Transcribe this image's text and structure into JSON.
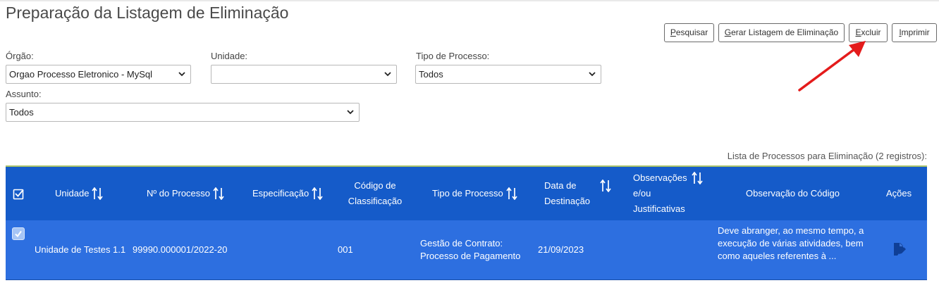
{
  "page": {
    "title": "Preparação da Listagem de Eliminação"
  },
  "toolbar": {
    "pesquisar": {
      "access_key": "P",
      "rest": "esquisar"
    },
    "gerar": {
      "access_key": "G",
      "rest": "erar Listagem de Eliminação"
    },
    "excluir": {
      "access_key": "E",
      "rest": "xcluir"
    },
    "imprimir": {
      "access_key": "I",
      "rest": "mprimir"
    }
  },
  "filters": {
    "orgao": {
      "label": "Órgão:",
      "value": "Orgao Processo Eletronico - MySql"
    },
    "unidade": {
      "label": "Unidade:",
      "value": ""
    },
    "tipo_processo": {
      "label": "Tipo de Processo:",
      "value": "Todos"
    },
    "assunto": {
      "label": "Assunto:",
      "value": "Todos"
    }
  },
  "table": {
    "caption": "Lista de Processos para Eliminação (2 registros):",
    "headers": {
      "unidade": "Unidade",
      "numero": "Nº do Processo",
      "especificacao": "Especificação",
      "codigo_1": "Código de",
      "codigo_2": "Classificação",
      "tipo": "Tipo de Processo",
      "data_1": "Data de",
      "data_2": "Destinação",
      "obs_1": "Observações",
      "obs_2": "e/ou",
      "obs_3": "Justificativas",
      "obs_codigo": "Observação do Código",
      "acoes": "Ações"
    },
    "rows": [
      {
        "checked": true,
        "unidade": "Unidade de Testes 1.1",
        "numero": "99990.000001/2022-20",
        "especificacao": "",
        "codigo": "001",
        "tipo_1": "Gestão de Contrato:",
        "tipo_2": "Processo de Pagamento",
        "data": "21/09/2023",
        "observacoes": "",
        "obs_codigo_1": "Deve abranger, ao mesmo tempo, a",
        "obs_codigo_2": "execução de várias atividades, bem",
        "obs_codigo_3": "como aqueles referentes à ..."
      }
    ]
  },
  "colors": {
    "header_bg": "#155bc9",
    "row_selected_bg": "#2d6fe0",
    "annotation_arrow": "#e41b1b"
  },
  "icons": [
    "chevron-down-icon",
    "sort-icon",
    "select-all-check-icon",
    "edit-document-icon"
  ]
}
